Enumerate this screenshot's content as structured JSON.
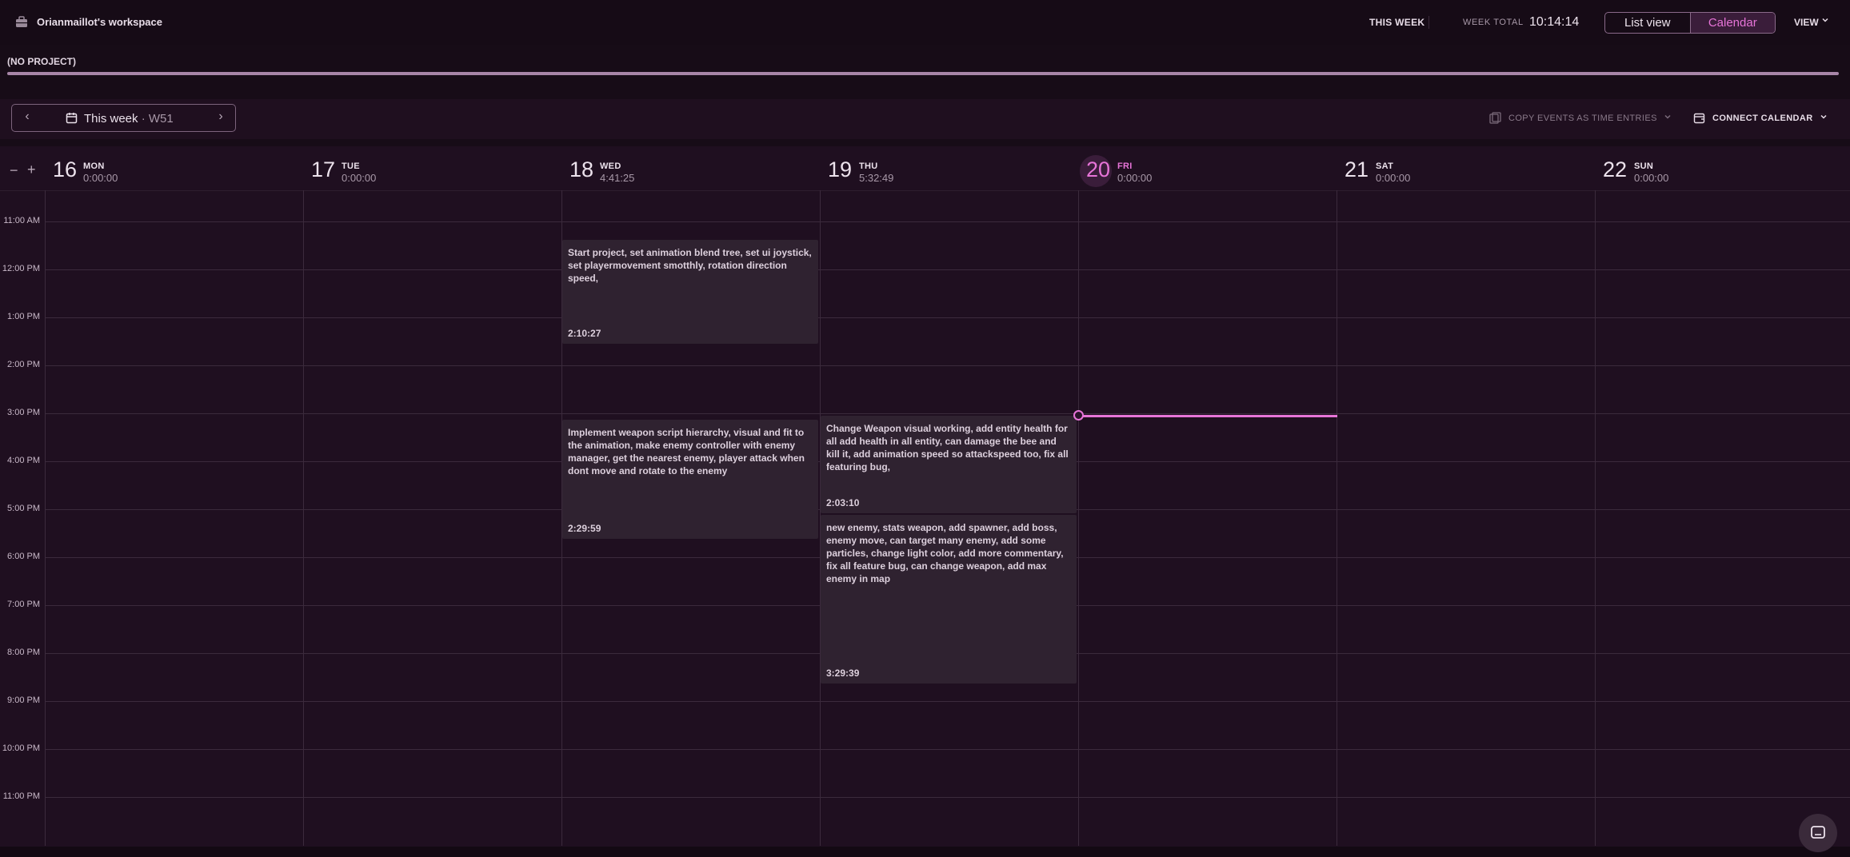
{
  "header": {
    "workspace_name": "Orianmaillot's workspace",
    "this_week_label": "THIS WEEK",
    "week_total_label": "WEEK TOTAL",
    "week_total_value": "10:14:14",
    "list_view_label": "List view",
    "calendar_label": "Calendar",
    "view_label": "VIEW",
    "active_view": "Calendar"
  },
  "project": {
    "label": "(NO PROJECT)",
    "bar_color": "#a886a8"
  },
  "nav": {
    "prev_glyph": "‹",
    "next_glyph": "›",
    "week_label": "This week",
    "week_number": "· W51",
    "copy_events_label": "COPY EVENTS AS TIME ENTRIES",
    "connect_calendar_label": "CONNECT CALENDAR"
  },
  "calendar": {
    "zoom_out": "−",
    "zoom_in": "+",
    "days": [
      {
        "num": "16",
        "name": "MON",
        "total": "0:00:00"
      },
      {
        "num": "17",
        "name": "TUE",
        "total": "0:00:00"
      },
      {
        "num": "18",
        "name": "WED",
        "total": "4:41:25"
      },
      {
        "num": "19",
        "name": "THU",
        "total": "5:32:49"
      },
      {
        "num": "20",
        "name": "FRI",
        "total": "0:00:00",
        "today": true
      },
      {
        "num": "21",
        "name": "SAT",
        "total": "0:00:00"
      },
      {
        "num": "22",
        "name": "SUN",
        "total": "0:00:00"
      }
    ],
    "hours": [
      "11:00 AM",
      "12:00 PM",
      "1:00 PM",
      "2:00 PM",
      "3:00 PM",
      "4:00 PM",
      "5:00 PM",
      "6:00 PM",
      "7:00 PM",
      "8:00 PM",
      "9:00 PM",
      "10:00 PM",
      "11:00 PM"
    ],
    "events": [
      {
        "description": "Start project, set animation blend tree, set ui joystick, set playermovement smotthly, rotation direction speed,",
        "duration": "2:10:27"
      },
      {
        "description": "Implement weapon script hierarchy, visual and fit to the animation, make enemy controller with enemy manager, get the nearest enemy, player attack when dont move and rotate to the enemy",
        "duration": "2:29:59"
      },
      {
        "description": "Change Weapon visual working, add entity health for all add health in all entity, can damage the bee and kill it, add animation speed so attackspeed too, fix all featuring bug,",
        "duration": "2:03:10"
      },
      {
        "description": "new enemy, stats weapon, add spawner, add boss, enemy move, can target many enemy, add some particles, change light color, add more commentary, fix all feature bug, can change weapon, add max enemy in map",
        "duration": "3:29:39"
      }
    ]
  },
  "colors": {
    "accent": "#e774d8",
    "background": "#1f0f20",
    "event_bg": "#2f2230"
  },
  "icons": [
    "briefcase-icon",
    "calendar-icon",
    "copy-events-icon",
    "connect-calendar-icon",
    "chevron-down-icon",
    "chat-icon",
    "current-time-marker-icon"
  ]
}
